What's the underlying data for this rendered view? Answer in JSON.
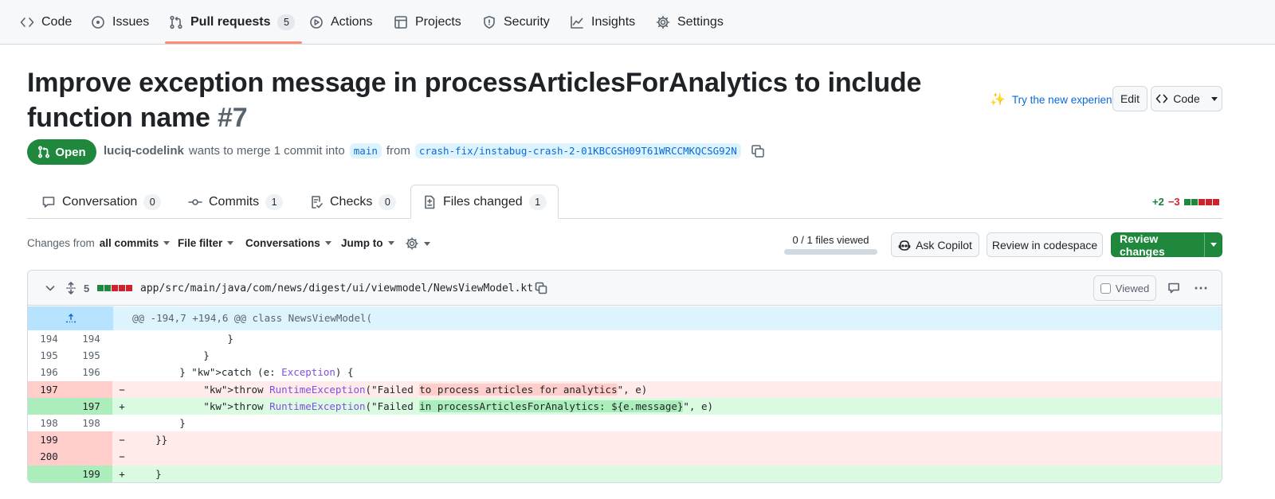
{
  "repo_nav": {
    "items": [
      {
        "label": "Code",
        "icon": "code-icon"
      },
      {
        "label": "Issues",
        "icon": "issue-icon"
      },
      {
        "label": "Pull requests",
        "icon": "pull-request-icon",
        "count": "5",
        "active": true
      },
      {
        "label": "Actions",
        "icon": "play-icon"
      },
      {
        "label": "Projects",
        "icon": "table-icon"
      },
      {
        "label": "Security",
        "icon": "shield-icon"
      },
      {
        "label": "Insights",
        "icon": "graph-icon"
      },
      {
        "label": "Settings",
        "icon": "gear-icon"
      }
    ]
  },
  "pr": {
    "title": "Improve exception message in processArticlesForAnalytics to include function name",
    "number": "#7",
    "try_new": "Try the new experience",
    "edit_label": "Edit",
    "code_label": "Code",
    "state": "Open",
    "author": "luciq-codelink",
    "merge_text": "wants to merge 1 commit into",
    "base_branch": "main",
    "from_text": "from",
    "head_branch": "crash-fix/instabug-crash-2-01KBCGSH09T61WRCCMKQCSG92N"
  },
  "tabs": [
    {
      "label": "Conversation",
      "count": "0",
      "icon": "comment-icon"
    },
    {
      "label": "Commits",
      "count": "1",
      "icon": "commit-icon"
    },
    {
      "label": "Checks",
      "count": "0",
      "icon": "checklist-icon"
    },
    {
      "label": "Files changed",
      "count": "1",
      "icon": "file-diff-icon",
      "active": true
    }
  ],
  "diffstat": {
    "additions": "+2",
    "deletions": "−3"
  },
  "toolbar": {
    "changes_from_prefix": "Changes from",
    "changes_from_value": "all commits",
    "file_filter": "File filter",
    "conversations": "Conversations",
    "jump_to": "Jump to",
    "files_viewed": "0 / 1 files viewed",
    "files_viewed_progress": 0,
    "ask_copilot": "Ask Copilot",
    "review_codespace": "Review in codespace",
    "review_changes": "Review changes"
  },
  "file": {
    "change_count": "5",
    "path": "app/src/main/java/com/news/digest/ui/viewmodel/NewsViewModel.kt",
    "viewed_label": "Viewed",
    "hunk_header": "@@ -194,7 +194,6 @@ class NewsViewModel(",
    "lines": [
      {
        "old": "194",
        "new": "194",
        "sign": "",
        "type": "ctx",
        "code": "                }"
      },
      {
        "old": "195",
        "new": "195",
        "sign": "",
        "type": "ctx",
        "code": "            }"
      },
      {
        "old": "196",
        "new": "196",
        "sign": "",
        "type": "ctx",
        "code": "        } catch (e: Exception) {"
      },
      {
        "old": "197",
        "new": "",
        "sign": "−",
        "type": "del",
        "code": "            throw RuntimeException(\"Failed to process articles for analytics\", e)"
      },
      {
        "old": "",
        "new": "197",
        "sign": "+",
        "type": "add",
        "code": "            throw RuntimeException(\"Failed in processArticlesForAnalytics: ${e.message}\", e)"
      },
      {
        "old": "198",
        "new": "198",
        "sign": "",
        "type": "ctx",
        "code": "        }"
      },
      {
        "old": "199",
        "new": "",
        "sign": "−",
        "type": "del",
        "code": "    }}"
      },
      {
        "old": "200",
        "new": "",
        "sign": "−",
        "type": "del",
        "code": ""
      },
      {
        "old": "",
        "new": "199",
        "sign": "+",
        "type": "add",
        "code": "    }"
      }
    ]
  },
  "colors": {
    "accent": "#0969da",
    "open_green": "#1f883d",
    "nav_underline": "#fd8c73",
    "add_bg": "#dafbe1",
    "del_bg": "#ffebe9",
    "hunk_bg": "#ddf4ff"
  }
}
